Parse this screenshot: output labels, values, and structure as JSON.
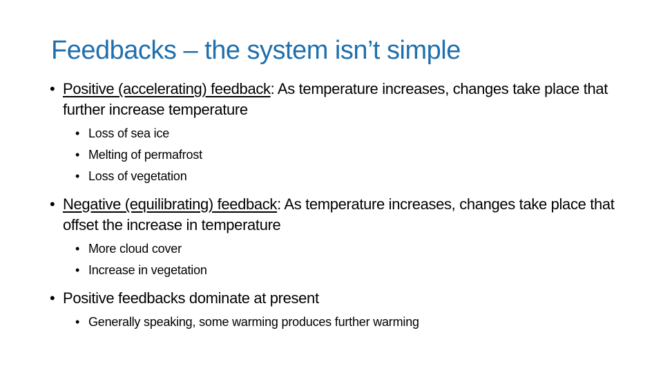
{
  "slide": {
    "title": "Feedbacks – the system isn’t simple",
    "title_color": "#1F6FAD",
    "bullet_glyph": "•",
    "items": [
      {
        "label": "Positive (accelerating) feedback",
        "text": ": As temperature increases, changes take place that further increase temperature",
        "children": [
          "Loss of sea ice",
          "Melting of permafrost",
          "Loss of vegetation"
        ]
      },
      {
        "label": "Negative (equilibrating) feedback",
        "text": ": As temperature increases, changes take place that offset the increase in temperature",
        "children": [
          "More cloud cover",
          "Increase in vegetation"
        ]
      },
      {
        "label": "",
        "text": "Positive feedbacks dominate at present",
        "children": [
          "Generally speaking, some warming produces further warming"
        ]
      }
    ]
  }
}
